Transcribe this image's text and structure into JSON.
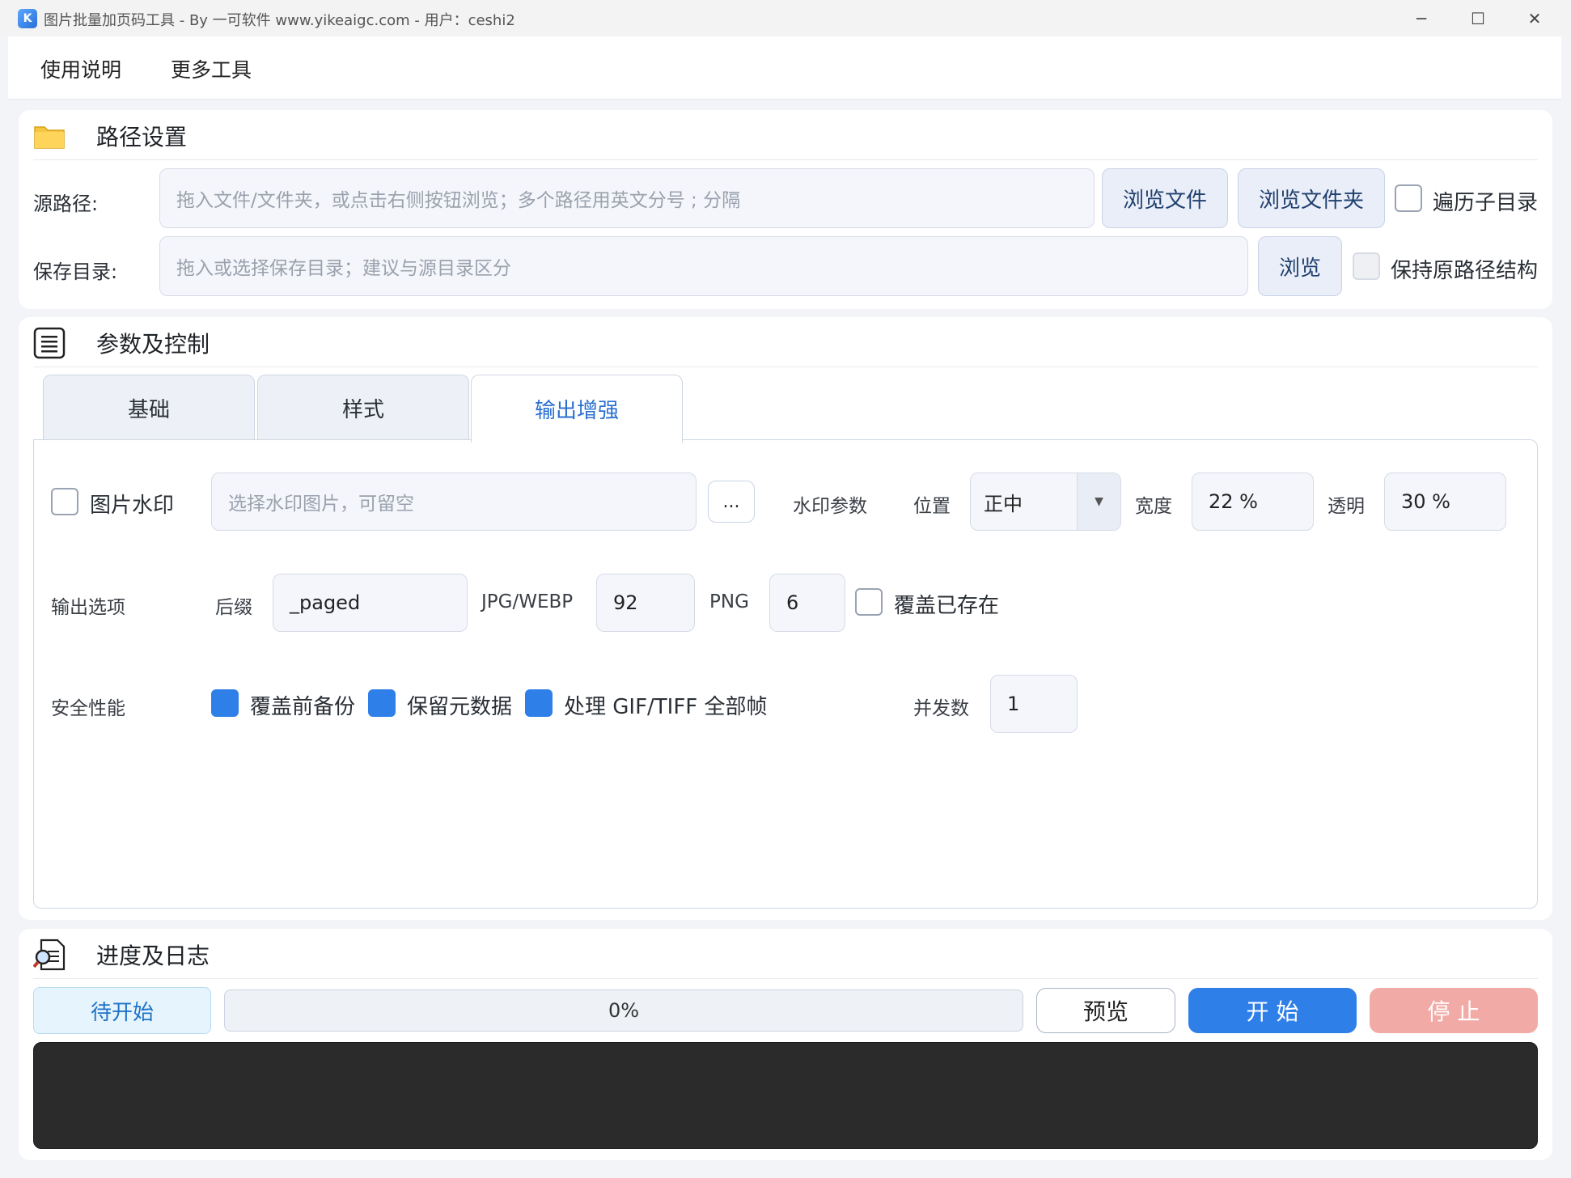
{
  "window": {
    "title": "图片批量加页码工具 - By 一可软件 www.yikeaigc.com  -  用户：ceshi2",
    "minimize_glyph": "─",
    "maximize_glyph": "☐",
    "close_glyph": "✕"
  },
  "menu": {
    "items": [
      "使用说明",
      "更多工具"
    ]
  },
  "path_panel": {
    "title": "路径设置",
    "icon": "folder-icon",
    "source_label": "源路径:",
    "source_placeholder": "拖入文件/文件夹，或点击右侧按钮浏览；多个路径用英文分号 ; 分隔",
    "browse_file": "浏览文件",
    "browse_folder": "浏览文件夹",
    "recurse_label": "遍历子目录",
    "recurse_checked": false,
    "save_label": "保存目录:",
    "save_placeholder": "拖入或选择保存目录；建议与源目录区分",
    "browse": "浏览",
    "keep_structure_label": "保持原路径结构",
    "keep_structure_checked": false
  },
  "params_panel": {
    "title": "参数及控制",
    "icon": "list-document-icon",
    "tabs": [
      {
        "label": "基础",
        "active": false
      },
      {
        "label": "样式",
        "active": false
      },
      {
        "label": "输出增强",
        "active": true
      }
    ],
    "watermark": {
      "label": "图片水印",
      "checked": false,
      "placeholder": "选择水印图片，可留空",
      "browse": "...",
      "params_label": "水印参数",
      "position_label": "位置",
      "position_value": "正中",
      "width_label": "宽度",
      "width_value": "22 %",
      "opacity_label": "透明",
      "opacity_value": "30 %"
    },
    "output": {
      "label": "输出选项",
      "suffix_label": "后缀",
      "suffix_value": "_paged",
      "jpg_label": "JPG/WEBP",
      "jpg_value": "92",
      "png_label": "PNG",
      "png_value": "6",
      "overwrite_label": "覆盖已存在",
      "overwrite_checked": false
    },
    "safety": {
      "label": "安全性能",
      "backup_label": "覆盖前备份",
      "backup_checked": true,
      "metadata_label": "保留元数据",
      "metadata_checked": true,
      "frames_label": "处理 GIF/TIFF 全部帧",
      "frames_checked": true,
      "concurrency_label": "并发数",
      "concurrency_value": "1"
    }
  },
  "progress_panel": {
    "title": "进度及日志",
    "icon": "magnifier-document-icon",
    "status": "待开始",
    "progress": 0,
    "progress_text": "0%",
    "preview": "预览",
    "start": "开 始",
    "stop": "停 止",
    "colors": {
      "accent": "#2f7fe8",
      "stop_disabled": "#f2aaa6",
      "log_bg": "#2b2b2b"
    }
  }
}
